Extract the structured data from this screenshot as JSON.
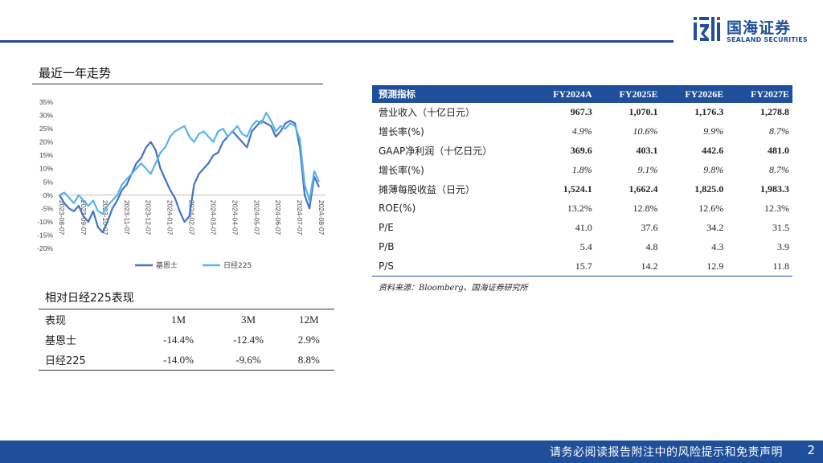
{
  "brand": {
    "name_cn": "国海证券",
    "name_en": "SEALAND SECURITIES"
  },
  "colors": {
    "brand_blue": "#1f4e9a",
    "series1": "#4472c4",
    "series2": "#5ab4e5"
  },
  "chart_section": {
    "title": "最近一年走势"
  },
  "chart_data": {
    "type": "line",
    "title": "",
    "x": [
      "2023-08-07",
      "2023-09-07",
      "2023-10-07",
      "2023-11-07",
      "2023-12-07",
      "2024-01-07",
      "2024-02-07",
      "2024-03-07",
      "2024-04-07",
      "2024-05-07",
      "2024-06-07",
      "2024-07-07",
      "2024-08-07"
    ],
    "y_ticks": [
      "35%",
      "30%",
      "25%",
      "20%",
      "15%",
      "10%",
      "5%",
      "0%",
      "-5%",
      "-10%",
      "-15%",
      "-20%"
    ],
    "ylim": [
      -20,
      35
    ],
    "legend_position": "bottom",
    "series": [
      {
        "name": "基恩士",
        "color": "#4472c4",
        "values": [
          0,
          -3,
          -5,
          -6,
          -4,
          -8,
          -10,
          -6,
          -12,
          -14,
          -10,
          -5,
          -2,
          2,
          4,
          8,
          12,
          14,
          18,
          20,
          17,
          10,
          6,
          2,
          -1,
          -6,
          -10,
          -8,
          4,
          8,
          10,
          12,
          15,
          16,
          20,
          22,
          24,
          22,
          20,
          18,
          24,
          26,
          28,
          27,
          26,
          22,
          24,
          27,
          28,
          27,
          18,
          0,
          -5,
          7,
          3
        ]
      },
      {
        "name": "日经225",
        "color": "#5ab4e5",
        "values": [
          0,
          1,
          -1,
          -3,
          0,
          -2,
          -4,
          -2,
          -6,
          -7,
          -4,
          -2,
          0,
          4,
          6,
          8,
          10,
          12,
          10,
          8,
          12,
          16,
          18,
          22,
          24,
          25,
          26,
          22,
          20,
          23,
          24,
          22,
          20,
          24,
          25,
          22,
          24,
          26,
          23,
          22,
          26,
          28,
          27,
          31,
          28,
          24,
          26,
          25,
          27,
          26,
          21,
          4,
          -2,
          9,
          5
        ]
      }
    ]
  },
  "forecast_table": {
    "headers": [
      "预测指标",
      "FY2024A",
      "FY2025E",
      "FY2026E",
      "FY2027E"
    ],
    "rows": [
      {
        "label": "营业收入（十亿日元）",
        "values": [
          "967.3",
          "1,070.1",
          "1,176.3",
          "1,278.8"
        ],
        "style": "bold"
      },
      {
        "label": "增长率(%)",
        "values": [
          "4.9%",
          "10.6%",
          "9.9%",
          "8.7%"
        ],
        "style": "ital"
      },
      {
        "label": "GAAP净利润（十亿日元）",
        "values": [
          "369.6",
          "403.1",
          "442.6",
          "481.0"
        ],
        "style": "bold"
      },
      {
        "label": "增长率(%)",
        "values": [
          "1.8%",
          "9.1%",
          "9.8%",
          "8.7%"
        ],
        "style": "ital"
      },
      {
        "label": "摊薄每股收益（日元）",
        "values": [
          "1,524.1",
          "1,662.4",
          "1,825.0",
          "1,983.3"
        ],
        "style": "bold"
      },
      {
        "label": "ROE(%)",
        "values": [
          "13.2%",
          "12.8%",
          "12.6%",
          "12.3%"
        ],
        "style": ""
      },
      {
        "label": "P/E",
        "values": [
          "41.0",
          "37.6",
          "34.2",
          "31.5"
        ],
        "style": ""
      },
      {
        "label": "P/B",
        "values": [
          "5.4",
          "4.8",
          "4.3",
          "3.9"
        ],
        "style": ""
      },
      {
        "label": "P/S",
        "values": [
          "15.7",
          "14.2",
          "12.9",
          "11.8"
        ],
        "style": ""
      }
    ],
    "source": "资料来源：Bloomberg、国海证券研究所"
  },
  "perf_section": {
    "title": "相对日经225表现",
    "headers": [
      "表现",
      "1M",
      "3M",
      "12M"
    ],
    "rows": [
      {
        "label": "基恩士",
        "values": [
          "-14.4%",
          "-12.4%",
          "2.9%"
        ]
      },
      {
        "label": "日经225",
        "values": [
          "-14.0%",
          "-9.6%",
          "8.8%"
        ]
      }
    ]
  },
  "footer": {
    "disclaimer": "请务必阅读报告附注中的风险提示和免责声明",
    "page": "2"
  }
}
